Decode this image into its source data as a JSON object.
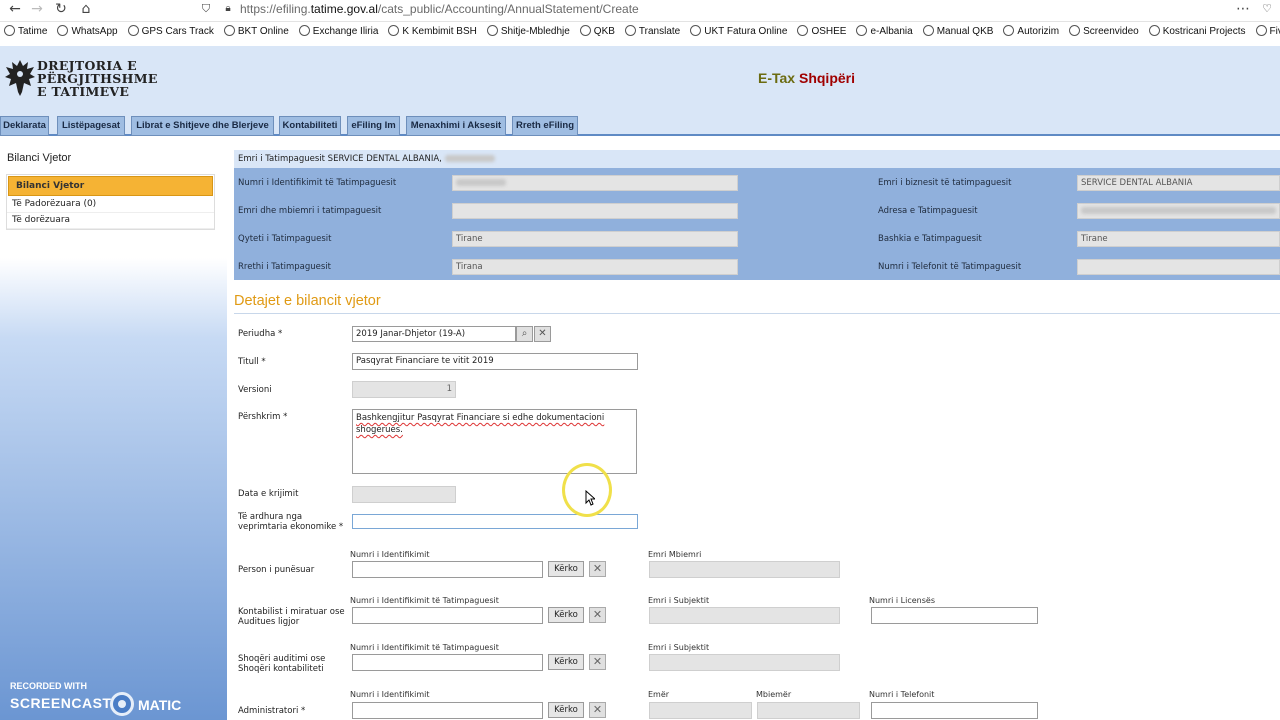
{
  "browser": {
    "url_prefix": "https://efiling.",
    "url_domain": "tatime.gov.al",
    "url_path": "/cats_public/Accounting/AnnualStatement/Create",
    "bookmarks": [
      "Tatime",
      "WhatsApp",
      "GPS Cars Track",
      "BKT Online",
      "Exchange Iliria",
      "K Kembimit BSH",
      "Shitje-Mbledhje",
      "QKB",
      "Translate",
      "UKT Fatura Online",
      "OSHEE",
      "e-Albania",
      "Manual QKB",
      "Autorizim",
      "Screenvideo",
      "Kostricani Projects",
      "Fiverr"
    ]
  },
  "header": {
    "logo_line1": "DREJTORIA E",
    "logo_line2": "PËRGJITHSHME",
    "logo_line3": "E TATIMEVE",
    "etax_a": "E-Tax",
    "etax_b": "Shqipëri",
    "etax_a_color": "#6b6b10",
    "etax_b_color": "#a00000"
  },
  "nav": [
    "Deklarata",
    "Listëpagesat",
    "Librat e Shitjeve dhe Blerjeve",
    "Kontabiliteti",
    "eFiling Im",
    "Menaxhimi i Aksesit",
    "Rreth eFiling"
  ],
  "sidebar": {
    "title": "Bilanci Vjetor",
    "items": [
      "Bilanci Vjetor",
      "Të Padorëzuara (0)",
      "Të dorëzuara"
    ]
  },
  "watermark": {
    "recorded": "RECORDED WITH",
    "screencast": "SCREENCAST",
    "matic": "MATIC"
  },
  "taxpayer": {
    "name_label": "Emri i Tatimpaguesit SERVICE DENTAL ALBANIA,",
    "nipt_label": "Numri i Identifikimit të Tatimpaguesit",
    "business_label": "Emri i biznesit të tatimpaguesit",
    "business_value": "SERVICE DENTAL ALBANIA",
    "owner_label": "Emri dhe mbiemri i tatimpaguesit",
    "address_label": "Adresa e Tatimpaguesit",
    "city_label": "Qyteti i Tatimpaguesit",
    "city_value": "Tirane",
    "municipality_label": "Bashkia e Tatimpaguesit",
    "municipality_value": "Tirane",
    "district_label": "Rrethi i Tatimpaguesit",
    "district_value": "Tirana",
    "phone_label": "Numri i Telefonit të Tatimpaguesit"
  },
  "form": {
    "section_title": "Detajet e bilancit vjetor",
    "period_label": "Periudha *",
    "period_value": "2019 Janar-Dhjetor (19-A)",
    "title_label": "Titull *",
    "title_value": "Pasqyrat Financiare te vitit 2019",
    "version_label": "Versioni",
    "version_value": "1",
    "desc_label": "Përshkrim *",
    "desc_value": "Bashkengjitur Pasqyrat Financiare si edhe dokumentacioni shogerues.",
    "created_label": "Data e krijimit",
    "revenue_label_1": "Të ardhura nga",
    "revenue_label_2": "veprimtaria ekonomike *",
    "employed_label": "Person i punësuar",
    "employed_id_label": "Numri i Identifikimit",
    "employed_name_label": "Emri Mbiemri",
    "accountant_label_1": "Kontabilist i miratuar ose",
    "accountant_label_2": "Auditues ligjor",
    "accountant_id_label": "Numri i Identifikimit të Tatimpaguesit",
    "accountant_subject_label": "Emri i Subjektit",
    "accountant_license_label": "Numri i Licensës",
    "audit_label_1": "Shoqëri auditimi ose",
    "audit_label_2": "Shoqëri kontabiliteti",
    "audit_id_label": "Numri i Identifikimit të Tatimpaguesit",
    "audit_subject_label": "Emri i Subjektit",
    "admin_label": "Administratori *",
    "admin_id_label": "Numri i Identifikimit",
    "admin_first_label": "Emër",
    "admin_last_label": "Mbiemër",
    "admin_phone_label": "Numri i Telefonit",
    "search_label": "Kërko"
  }
}
